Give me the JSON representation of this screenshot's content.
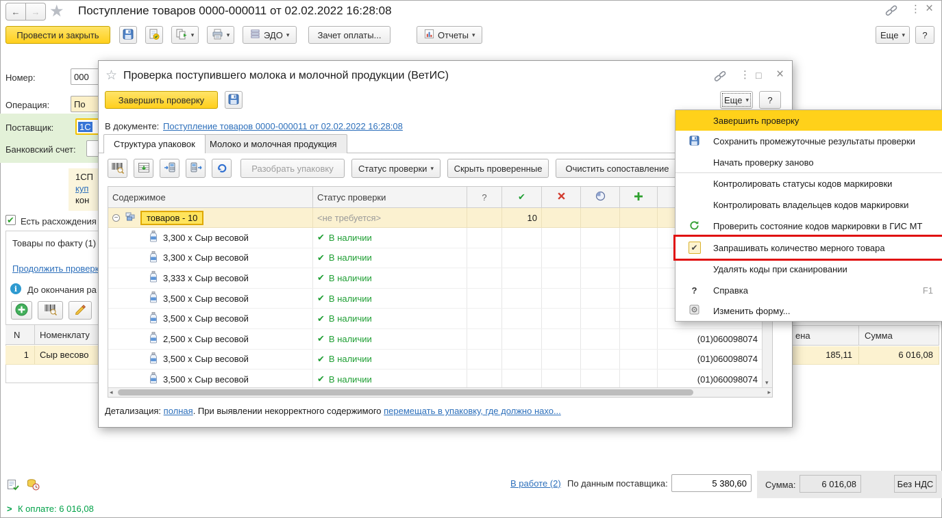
{
  "colors": {
    "accent_yellow": "#FFD11A",
    "link_blue": "#2C6FBB",
    "status_green": "#1E9E33",
    "error_red": "#D92B2B",
    "highlight_red": "#E01010",
    "row_cream": "#FDF1CE",
    "panel_green": "#E3F1D8"
  },
  "main": {
    "title": "Поступление товаров 0000-000011 от 02.02.2022 16:28:08",
    "toolbar": {
      "post_and_close": "Провести и закрыть",
      "edo": "ЭДО",
      "payment_offset": "Зачет оплаты...",
      "reports": "Отчеты",
      "more": "Еще",
      "help": "?"
    },
    "fields": {
      "number_label": "Номер:",
      "number_value": "000",
      "operation_label": "Операция:",
      "operation_value": "По",
      "supplier_label": "Поставщик:",
      "supplier_value": "1С",
      "bank_account_label": "Банковский счет:",
      "spark_line1": "1СП",
      "spark_line2": "куп",
      "spark_line3": "кон",
      "discrepancies_label": "Есть расхождения"
    },
    "goods": {
      "tab_label": "Товары по факту (1)",
      "continue_link": "Продолжить проверк",
      "deadline_text": "До окончания ра",
      "col_n": "N",
      "col_nomenclature": "Номенклату",
      "row_num": "1",
      "row_name": "Сыр весово"
    },
    "bg_table": {
      "price_header": "ена",
      "sum_header": "Сумма",
      "price_value": "185,11",
      "sum_value": "6 016,08"
    },
    "footer": {
      "in_progress": "В работе (2)",
      "by_supplier_label": "По данным поставщика:",
      "by_supplier_value": "5 380,60",
      "sum_label": "Сумма:",
      "sum_value": "6 016,08",
      "vat_label": "Без НДС",
      "to_pay": "К оплате: 6 016,08",
      "to_pay_chevron": ">"
    }
  },
  "modal": {
    "title": "Проверка поступившего молока и молочной продукции (ВетИС)",
    "finish_button": "Завершить проверку",
    "more_button": "Еще",
    "help_button": "?",
    "in_document_label": "В документе:",
    "document_link": "Поступление товаров 0000-000011 от 02.02.2022 16:28:08",
    "tab_structure": "Структура упаковок",
    "tab_milk": "Молоко и молочная продукция",
    "toolbar": {
      "disassemble": "Разобрать упаковку",
      "check_status": "Статус проверки",
      "hide_checked": "Скрыть проверенные",
      "clear_matching": "Очистить сопоставление"
    },
    "table": {
      "col_content": "Содержимое",
      "col_status": "Статус проверки",
      "col_question": "?",
      "group": {
        "label": "товаров - 10",
        "status": "<не требуется>",
        "count": "10"
      },
      "rows": [
        {
          "name": "3,300 x Сыр весовой",
          "status": "В наличии",
          "code": ""
        },
        {
          "name": "3,300 x Сыр весовой",
          "status": "В наличии",
          "code": ""
        },
        {
          "name": "3,333 x Сыр весовой",
          "status": "В наличии",
          "code": ""
        },
        {
          "name": "3,500 x Сыр весовой",
          "status": "В наличии",
          "code": ""
        },
        {
          "name": "3,500 x Сыр весовой",
          "status": "В наличии",
          "code": ""
        },
        {
          "name": "2,500 x Сыр весовой",
          "status": "В наличии",
          "code": "(01)060098074"
        },
        {
          "name": "3,500 x Сыр весовой",
          "status": "В наличии",
          "code": "(01)060098074"
        },
        {
          "name": "3,500 x Сыр весовой",
          "status": "В наличии",
          "code": "(01)060098074"
        }
      ]
    },
    "footer": {
      "prefix": "Детализация:",
      "link1": "полная",
      "middle": ". При выявлении некорректного содержимого",
      "link2": "перемещать в упаковку, где должно нахо..."
    }
  },
  "menu": {
    "item1": "Завершить проверку",
    "item2": "Сохранить промежуточные результаты проверки",
    "item3": "Начать проверку заново",
    "item4": "Контролировать статусы кодов маркировки",
    "item5": "Контролировать владельцев кодов маркировки",
    "item6": "Проверить состояние кодов маркировки в ГИС МТ",
    "item7": "Запрашивать количество мерного товара",
    "item8": "Удалять коды при сканировании",
    "item9": "Справка",
    "item9_shortcut": "F1",
    "item10": "Изменить форму..."
  }
}
